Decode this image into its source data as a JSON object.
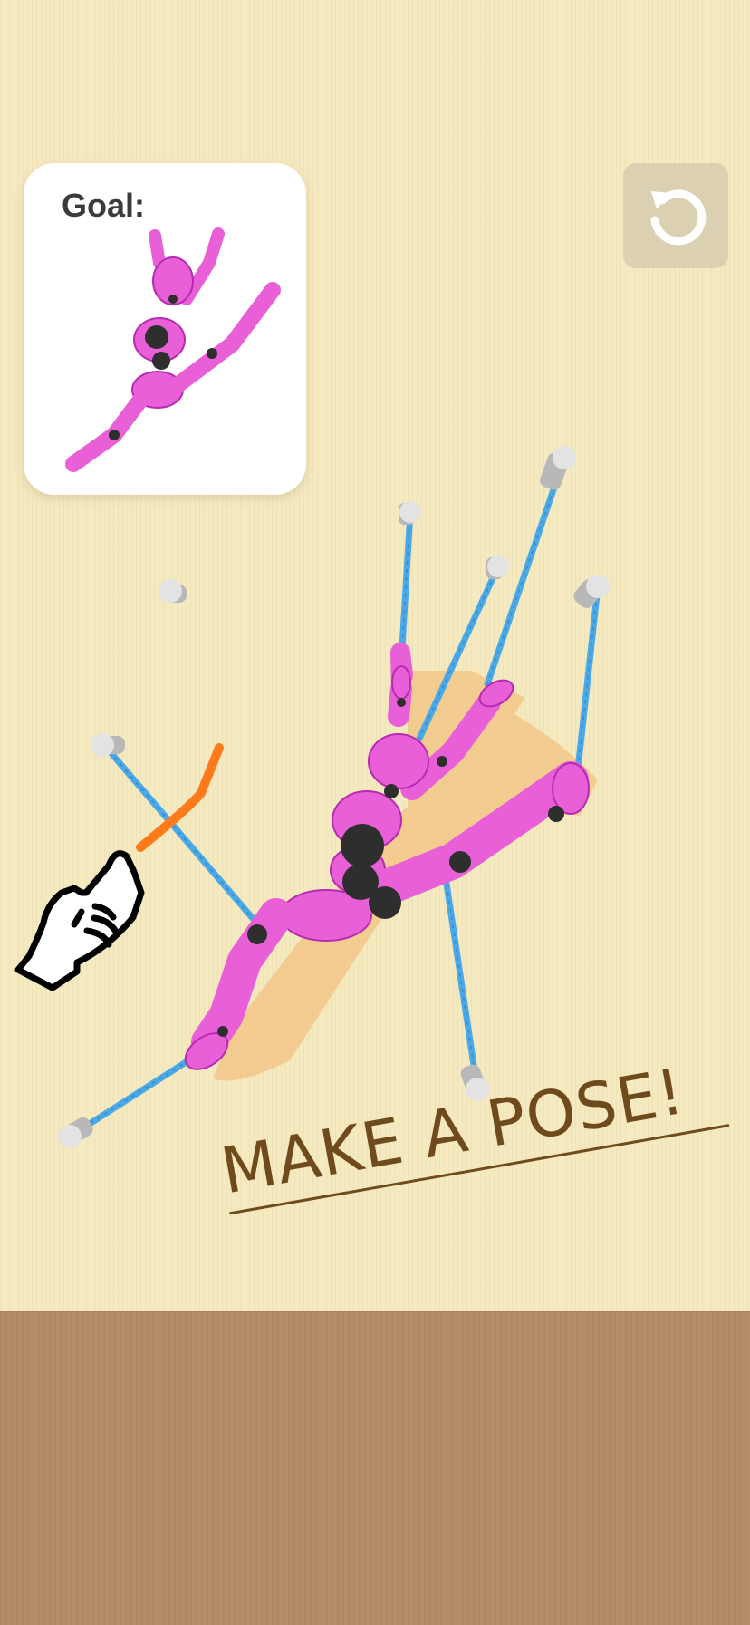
{
  "goal": {
    "label": "Goal:"
  },
  "toolbar": {
    "reset_icon": "undo-arrow-icon"
  },
  "banner": {
    "text": "MAKE A POSE!"
  },
  "colors": {
    "wall": "#f5e9c0",
    "floor": "#b48e69",
    "figure": "#e85fd8",
    "rope": "#4aa9e6",
    "pin": "#d9d9d9",
    "stroke": "#ff7a1a",
    "text": "#6e4a1c"
  },
  "hint": {
    "icon": "pointing-hand-icon"
  }
}
